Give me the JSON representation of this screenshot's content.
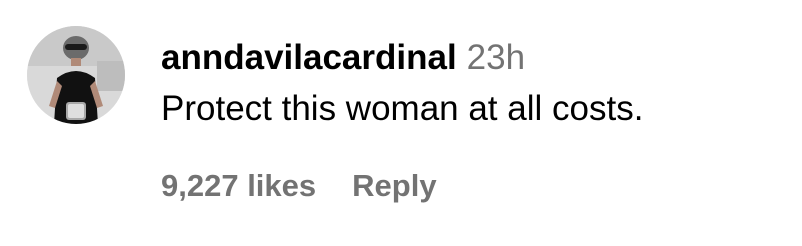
{
  "comment": {
    "username": "anndavilacardinal",
    "timestamp": "23h",
    "text": "Protect this woman at all costs.",
    "likes": "9,227 likes",
    "reply_label": "Reply",
    "avatar_icon": "profile-photo"
  }
}
